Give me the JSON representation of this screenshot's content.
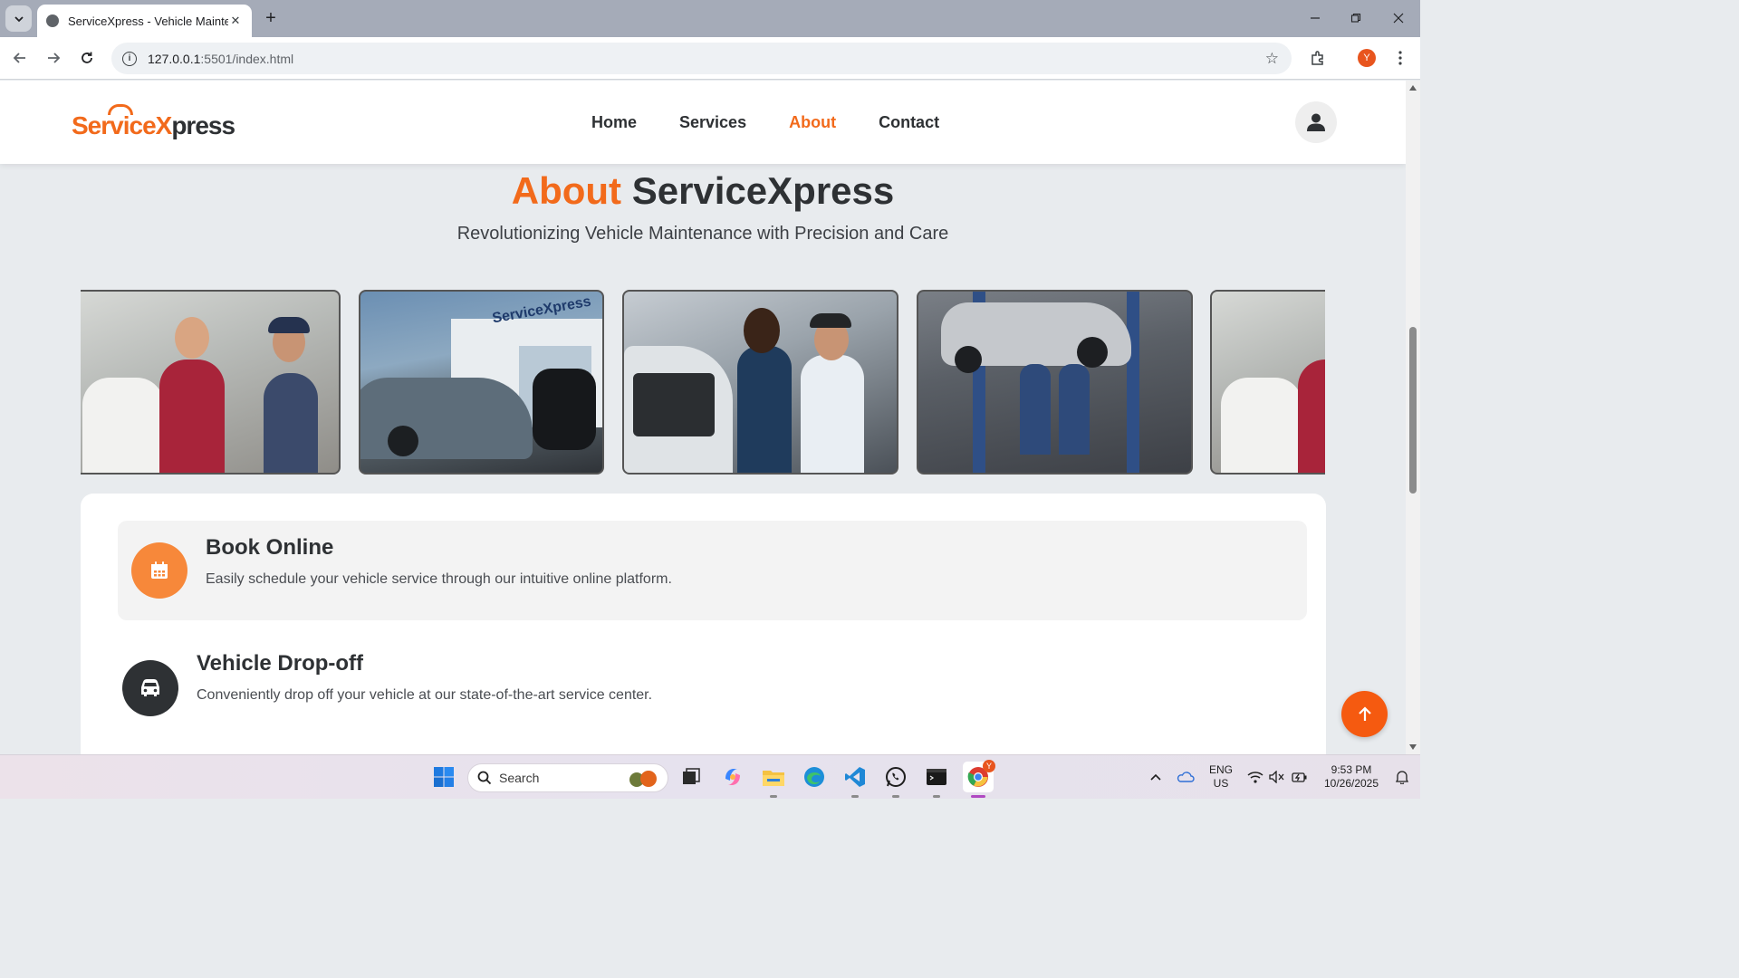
{
  "browser": {
    "tab_title": "ServiceXpress - Vehicle Maintenance",
    "url_host": "127.0.0.1",
    "url_rest": ":5501/index.html",
    "profile_initial": "Y"
  },
  "site": {
    "logo_main": "Service",
    "logo_x": "X",
    "logo_end": "press",
    "nav": [
      "Home",
      "Services",
      "About",
      "Contact"
    ],
    "active_nav": "About"
  },
  "about": {
    "title_accent": "About",
    "title_rest": " ServiceXpress",
    "subtitle": "Revolutionizing Vehicle Maintenance with Precision and Care",
    "gallery_banner": "ServiceXpress"
  },
  "steps": [
    {
      "title": "Book Online",
      "description": "Easily schedule your vehicle service through our intuitive online platform.",
      "icon": "calendar-icon"
    },
    {
      "title": "Vehicle Drop-off",
      "description": "Conveniently drop off your vehicle at our state-of-the-art service center.",
      "icon": "car-icon"
    }
  ],
  "colors": {
    "accent": "#f26a1b",
    "dark": "#2e3134",
    "scroll_top": "#f55a10"
  },
  "taskbar": {
    "search_label": "Search",
    "lang_line1": "ENG",
    "lang_line2": "US",
    "time": "9:53 PM",
    "date": "10/26/2025",
    "chrome_badge": "Y"
  }
}
